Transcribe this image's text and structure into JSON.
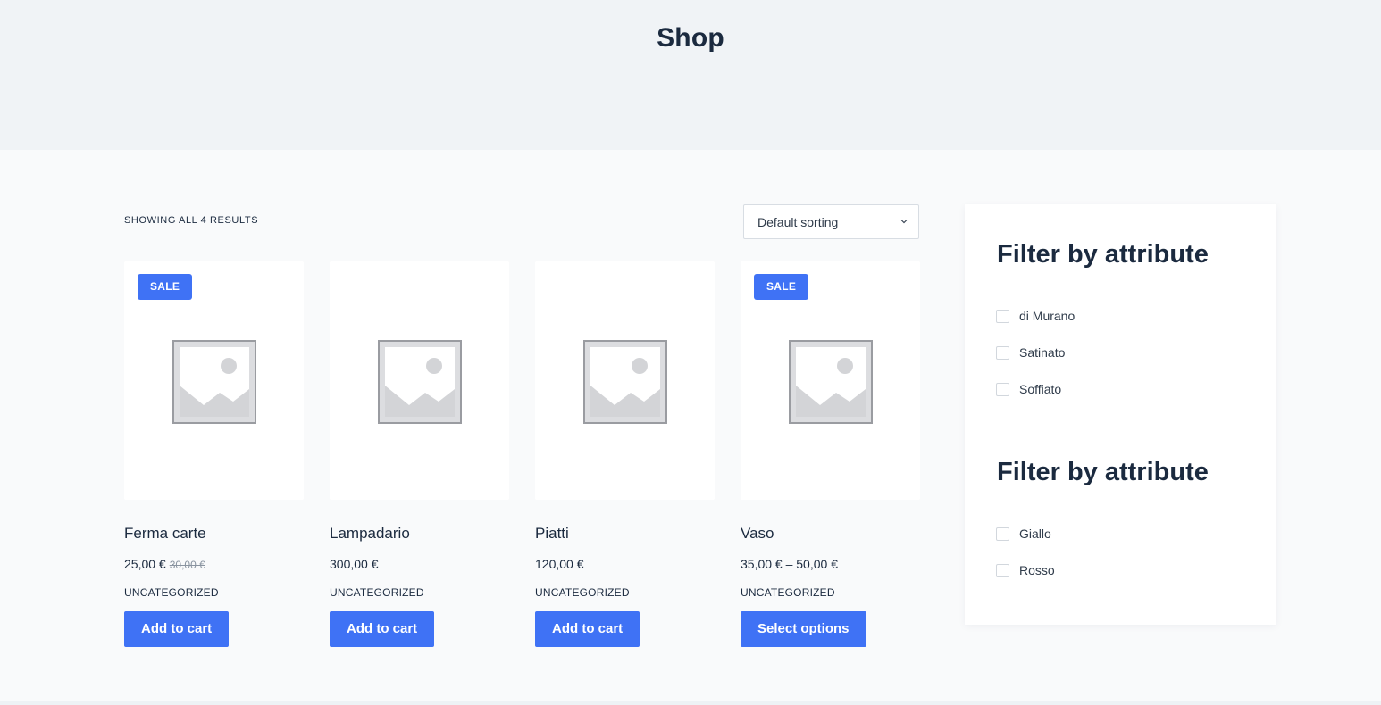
{
  "page_title": "Shop",
  "result_count": "SHOWING ALL 4 RESULTS",
  "sorting": {
    "selected": "Default sorting"
  },
  "products": [
    {
      "name": "Ferma carte",
      "price": "25,00 €",
      "old_price": "30,00 €",
      "category": "UNCATEGORIZED",
      "button": "Add to cart",
      "badge": "SALE"
    },
    {
      "name": "Lampadario",
      "price": "300,00 €",
      "category": "UNCATEGORIZED",
      "button": "Add to cart"
    },
    {
      "name": "Piatti",
      "price": "120,00 €",
      "category": "UNCATEGORIZED",
      "button": "Add to cart"
    },
    {
      "name": "Vaso",
      "price": "35,00 € – 50,00 €",
      "category": "UNCATEGORIZED",
      "button": "Select options",
      "badge": "SALE"
    }
  ],
  "filters": [
    {
      "title": "Filter by attribute",
      "options": [
        "di Murano",
        "Satinato",
        "Soffiato"
      ]
    },
    {
      "title": "Filter by attribute",
      "options": [
        "Giallo",
        "Rosso"
      ]
    }
  ],
  "colors": {
    "accent": "#3f72f5",
    "text": "#1b2a3f",
    "hero_bg": "#f0f3f6",
    "content_bg": "#f9fafb"
  },
  "icons": {
    "placeholder": "image-placeholder-icon",
    "select_arrow": "chevron-down-icon"
  }
}
